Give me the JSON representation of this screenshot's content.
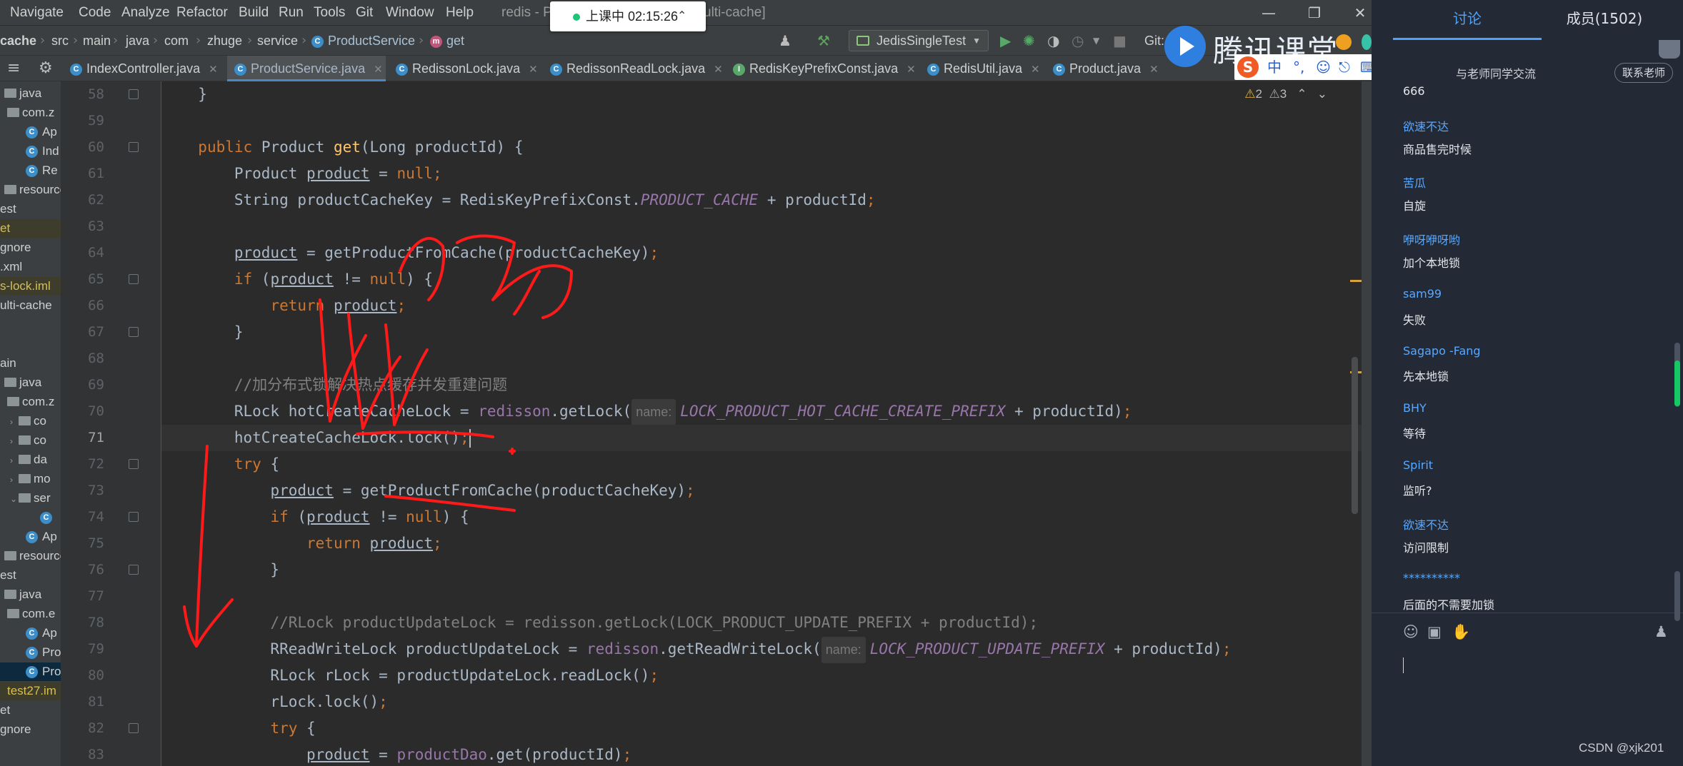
{
  "menu": [
    "Navigate",
    "Code",
    "Analyze",
    "Refactor",
    "Build",
    "Run",
    "Tools",
    "Git",
    "Window",
    "Help"
  ],
  "window_title_left": "redis - P",
  "window_title_right": "ulti-cache]",
  "live_badge": "上课中 02:15:26",
  "breadcrumb": {
    "items": [
      "cache",
      "src",
      "main",
      "java",
      "com",
      "zhuge",
      "service",
      "ProductService",
      "get"
    ]
  },
  "run_config": "JedisSingleTest",
  "git_label": "Git:",
  "tabs": [
    {
      "label": "IndexController.java",
      "icon": "C"
    },
    {
      "label": "ProductService.java",
      "icon": "C"
    },
    {
      "label": "RedissonLock.java",
      "icon": "C"
    },
    {
      "label": "RedissonReadLock.java",
      "icon": "C"
    },
    {
      "label": "RedisKeyPrefixConst.java",
      "icon": "I"
    },
    {
      "label": "RedisUtil.java",
      "icon": "C"
    },
    {
      "label": "Product.java",
      "icon": "C"
    }
  ],
  "inspections": {
    "warnings": "2",
    "weak": "3"
  },
  "tree": [
    {
      "label": "java",
      "type": "folder"
    },
    {
      "label": "com.z",
      "type": "folder"
    },
    {
      "label": "Ap",
      "type": "class"
    },
    {
      "label": "Ind",
      "type": "class"
    },
    {
      "label": "Re",
      "type": "class"
    },
    {
      "label": "resources",
      "type": "folder"
    },
    {
      "label": "est",
      "type": "text"
    },
    {
      "label": "et",
      "type": "text"
    },
    {
      "label": "gnore",
      "type": "text"
    },
    {
      "label": ".xml",
      "type": "text"
    },
    {
      "label": "s-lock.iml",
      "type": "text"
    },
    {
      "label": "ulti-cache",
      "type": "text"
    },
    {
      "label": "",
      "type": "text"
    },
    {
      "label": "",
      "type": "text"
    },
    {
      "label": "ain",
      "type": "text"
    },
    {
      "label": "java",
      "type": "folder"
    },
    {
      "label": "com.z",
      "type": "folder"
    },
    {
      "label": "co",
      "type": "folder"
    },
    {
      "label": "co",
      "type": "folder"
    },
    {
      "label": "da",
      "type": "folder"
    },
    {
      "label": "mo",
      "type": "folder"
    },
    {
      "label": "ser",
      "type": "folder"
    },
    {
      "label": "",
      "type": "class"
    },
    {
      "label": "Ap",
      "type": "class"
    },
    {
      "label": "resources",
      "type": "folder"
    },
    {
      "label": "est",
      "type": "text"
    },
    {
      "label": "java",
      "type": "folder"
    },
    {
      "label": "com.e",
      "type": "folder"
    },
    {
      "label": "Ap",
      "type": "class"
    },
    {
      "label": "Pro",
      "type": "class"
    },
    {
      "label": "Pro",
      "type": "class"
    },
    {
      "label": "test27.im",
      "type": "text"
    },
    {
      "label": "et",
      "type": "text"
    },
    {
      "label": "gnore",
      "type": "text"
    }
  ],
  "code": {
    "line_numbers": [
      "58",
      "59",
      "60",
      "61",
      "62",
      "63",
      "64",
      "65",
      "66",
      "67",
      "68",
      "69",
      "70",
      "71",
      "72",
      "73",
      "74",
      "75",
      "76",
      "77",
      "78",
      "79",
      "80",
      "81",
      "82",
      "83"
    ],
    "current_line": "71",
    "hint_name": "name:",
    "comment_69": "//加分布式锁解决热点缓存并发重建问题",
    "comment_78": "//RLock productUpdateLock = redisson.getLock(LOCK_PRODUCT_UPDATE_PREFIX + productId);"
  },
  "chat": {
    "tab_discuss": "讨论",
    "tab_members": "成员(1502)",
    "teacher_note": "与老师同学交流",
    "contact_button": "联系老师",
    "messages": [
      {
        "user": "",
        "text": "666"
      },
      {
        "user": "欲速不达",
        "text": "商品售完时候"
      },
      {
        "user": "苦瓜",
        "text": "自旋"
      },
      {
        "user": "咿呀咿呀哟",
        "text": "加个本地锁"
      },
      {
        "user": "sam99",
        "text": "失败"
      },
      {
        "user": "Sagapo -Fang",
        "text": "先本地锁"
      },
      {
        "user": "BHY",
        "text": "等待"
      },
      {
        "user": "Spirit",
        "text": "监听?"
      },
      {
        "user": "欲速不达",
        "text": "访问限制"
      },
      {
        "user": "**********",
        "text": "后面的不需要加锁"
      }
    ],
    "watermark": "CSDN @xjk201"
  },
  "overlay": {
    "brand_text": "腾讯课堂",
    "ime_mode": "中"
  },
  "colors": {
    "keyword": "#cc7832",
    "field": "#9876aa",
    "method": "#ffc66d",
    "comment": "#808080",
    "annotation_red": "#ff1a1a",
    "chat_user": "#58a8ff"
  }
}
